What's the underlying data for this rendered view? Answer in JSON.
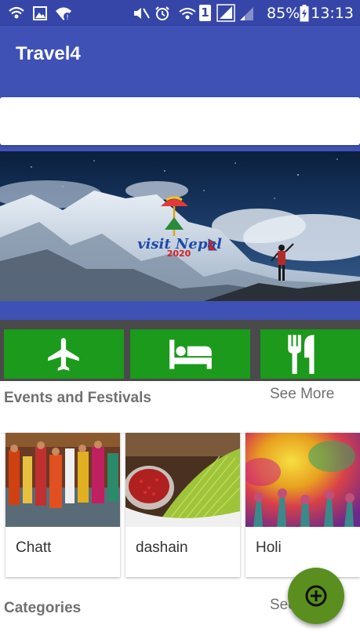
{
  "status_bar": {
    "battery_percent": "85%",
    "time": "13:13",
    "sim_slot": "1",
    "icons": [
      "wifi-calling-icon",
      "image-notification-icon",
      "wifi-alert-icon",
      "mute-icon",
      "alarm-icon",
      "wifi-icon",
      "sim-icon",
      "signal-icon",
      "signal-weak-icon",
      "battery-charging-icon"
    ]
  },
  "app_bar": {
    "title": "Travel4"
  },
  "search": {
    "placeholder": ""
  },
  "banner": {
    "logo_text": "visit Nepal",
    "logo_year": "2020"
  },
  "quick_actions": [
    {
      "label": "Flights",
      "icon": "airplane-icon"
    },
    {
      "label": "Hotels",
      "icon": "bed-icon"
    },
    {
      "label": "Restaurants",
      "icon": "fork-knife-icon"
    }
  ],
  "events": {
    "title": "Events and Festivals",
    "see_more": "See More",
    "items": [
      {
        "name": "Chatt"
      },
      {
        "name": "dashain"
      },
      {
        "name": "Holi"
      }
    ]
  },
  "categories": {
    "title": "Categories",
    "see_more": "See More"
  },
  "fab": {
    "icon": "add-circle-icon"
  },
  "colors": {
    "status_bar": "#3646a8",
    "primary": "#3f51b5",
    "quick_action_green": "#1b9a1b",
    "fab_green": "#5a8f1f",
    "dark_strip": "#4a4a4a"
  }
}
